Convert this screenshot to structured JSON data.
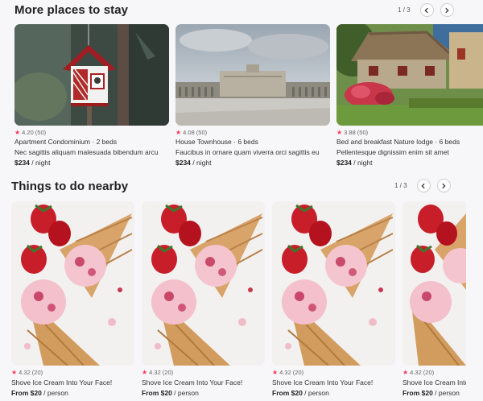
{
  "stays": {
    "title": "More places to stay",
    "pager": "1 / 3",
    "cards": [
      {
        "rating": "4.20",
        "reviews": "(50)",
        "line1": "Apartment Condominium · 2 beds",
        "line2": "Nec sagittis aliquam malesuada bibendum arcu",
        "price": "$234",
        "unit": " / night",
        "image": "birdhouse-photo"
      },
      {
        "rating": "4.08",
        "reviews": "(50)",
        "line1": "House Townhouse · 6 beds",
        "line2": "Faucibus in ornare quam viverra orci sagittis eu",
        "price": "$234",
        "unit": " / night",
        "image": "palace-photo"
      },
      {
        "rating": "3.88",
        "reviews": "(50)",
        "line1": "Bed and breakfast Nature lodge · 6 beds",
        "line2": "Pellentesque dignissim enim sit amet",
        "price": "$234",
        "unit": " / night",
        "image": "cottage-photo"
      }
    ]
  },
  "things": {
    "title": "Things to do nearby",
    "pager": "1 / 3",
    "cards": [
      {
        "rating": "4.32",
        "reviews": "(20)",
        "line1": "Shove Ice Cream Into Your Face!",
        "price": "From $20",
        "unit": " / person",
        "image": "ice-cream-photo"
      },
      {
        "rating": "4.32",
        "reviews": "(20)",
        "line1": "Shove Ice Cream Into Your Face!",
        "price": "From $20",
        "unit": " / person",
        "image": "ice-cream-photo"
      },
      {
        "rating": "4.32",
        "reviews": "(20)",
        "line1": "Shove Ice Cream Into Your Face!",
        "price": "From $20",
        "unit": " / person",
        "image": "ice-cream-photo"
      },
      {
        "rating": "4.32",
        "reviews": "(20)",
        "line1": "Shove Ice Cream Into Your Face!",
        "price": "From $20",
        "unit": " / person",
        "image": "ice-cream-photo"
      }
    ]
  },
  "icons": {
    "star": "star-icon",
    "prev": "chevron-left-icon",
    "next": "chevron-right-icon"
  },
  "colors": {
    "star": "#ff385c",
    "text": "#222222",
    "background": "#f7f6f8"
  }
}
